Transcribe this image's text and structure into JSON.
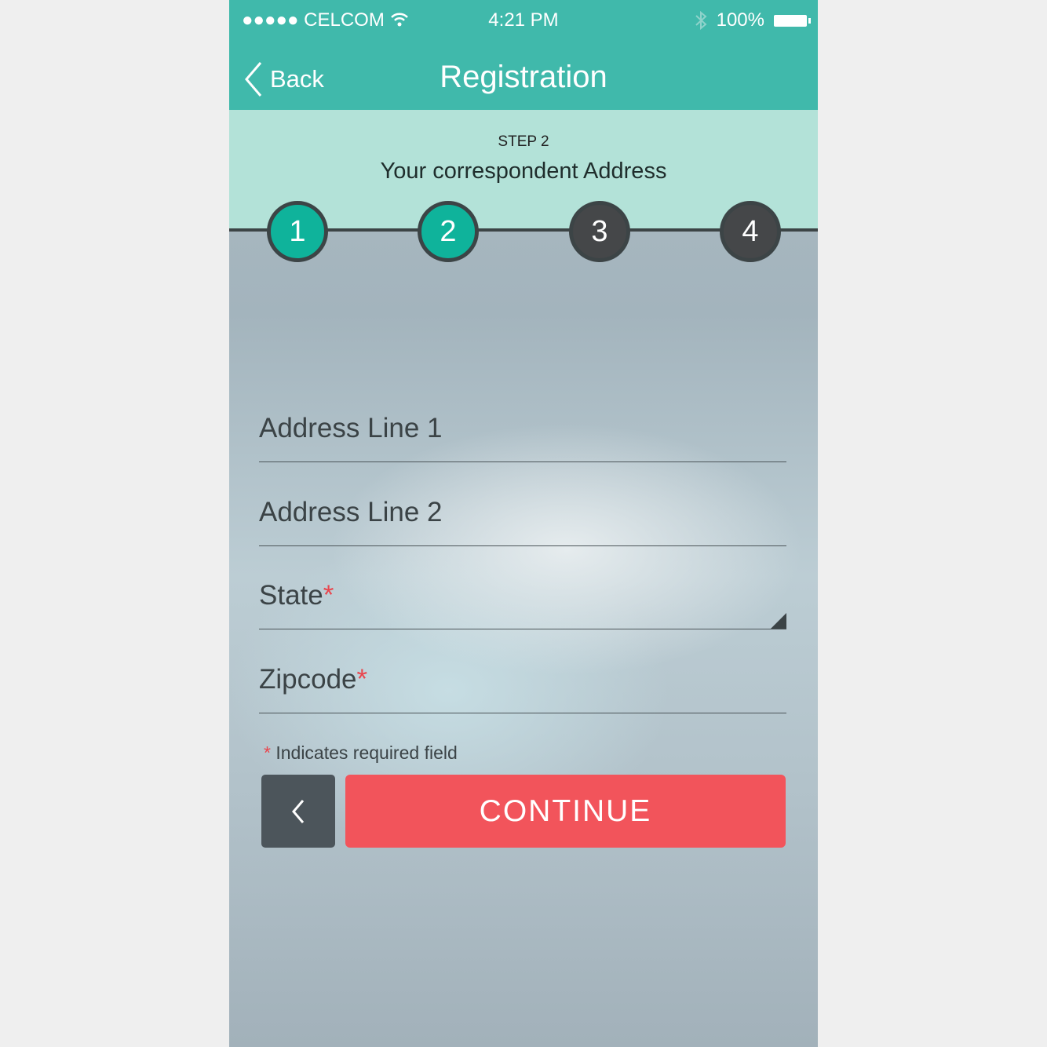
{
  "status_bar": {
    "signal": "●●●●●",
    "carrier": "CELCOM",
    "time": "4:21 PM",
    "battery": "100%"
  },
  "nav": {
    "back_label": "Back",
    "title": "Registration"
  },
  "step": {
    "label": "STEP 2",
    "subtitle": "Your correspondent Address",
    "steps": [
      "1",
      "2",
      "3",
      "4"
    ],
    "current": 2
  },
  "form": {
    "fields": [
      {
        "label": "Address Line 1",
        "required": false
      },
      {
        "label": "Address Line 2",
        "required": false
      },
      {
        "label": "State",
        "required": true
      },
      {
        "label": "Zipcode",
        "required": true
      }
    ],
    "required_mark": "*",
    "note": "Indicates required field"
  },
  "actions": {
    "continue_label": "CONTINUE"
  },
  "colors": {
    "header": "#40b9ab",
    "step_done": "#0fb39b",
    "step_todo": "#454749",
    "continue": "#f2545b"
  }
}
